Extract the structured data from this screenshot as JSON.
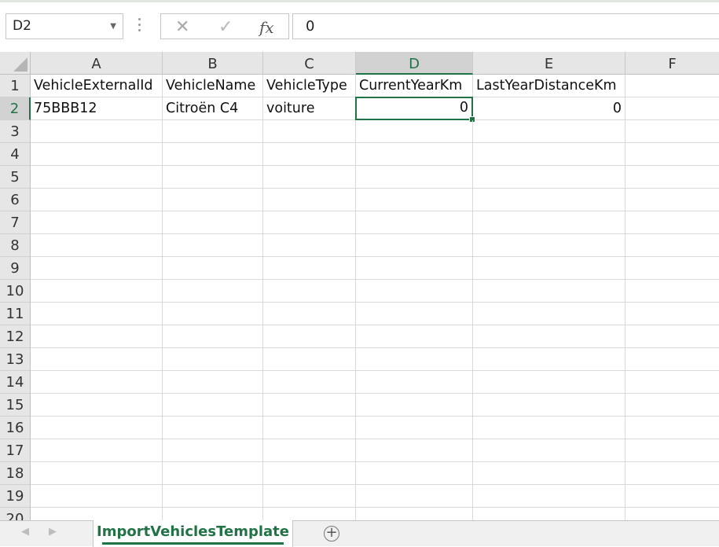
{
  "name_box": {
    "value": "D2"
  },
  "formula_bar": {
    "cancel_icon": "close-icon",
    "enter_icon": "checkmark-icon",
    "fx_label": "fx",
    "value": "0"
  },
  "columns": [
    "A",
    "B",
    "C",
    "D",
    "E",
    "F"
  ],
  "selected_column": "D",
  "rows": [
    "1",
    "2",
    "3",
    "4",
    "5",
    "6",
    "7",
    "8",
    "9",
    "10",
    "11",
    "12",
    "13",
    "14",
    "15",
    "16",
    "17",
    "18",
    "19",
    "20"
  ],
  "selected_row": "2",
  "cells": {
    "row1": [
      "VehicleExternalId",
      "VehicleName",
      "VehicleType",
      "CurrentYearKm",
      "LastYearDistanceKm",
      ""
    ],
    "row2": [
      "75BBB12",
      "Citroën C4",
      "voiture",
      "0",
      "0",
      ""
    ]
  },
  "sheet_tabs": {
    "active": "ImportVehiclesTemplate",
    "add_icon": "plus-circle-icon"
  },
  "colors": {
    "accent": "#217346"
  }
}
